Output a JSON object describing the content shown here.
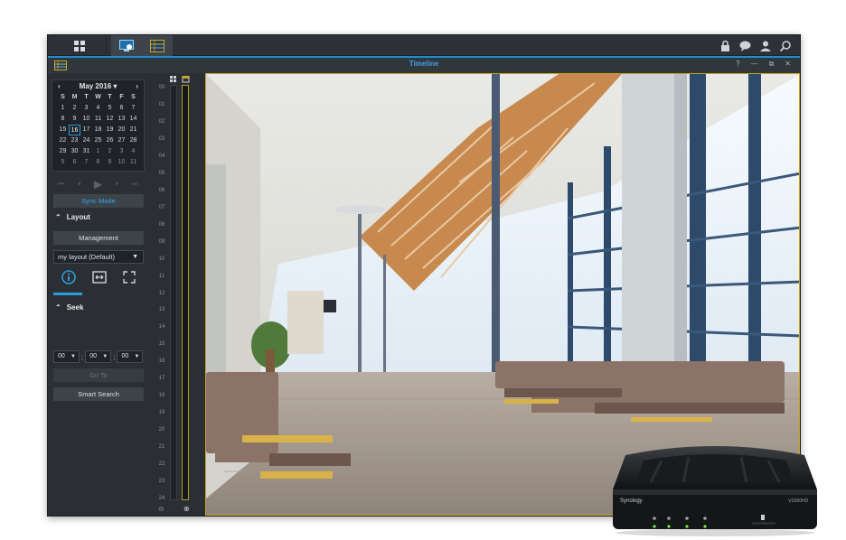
{
  "window": {
    "title": "Timeline",
    "controls": [
      "?",
      "—",
      "⧉",
      "✕"
    ]
  },
  "calendar": {
    "month_label": "May 2016",
    "prev": "‹",
    "next": "›",
    "dow": [
      "S",
      "M",
      "T",
      "W",
      "T",
      "F",
      "S"
    ],
    "weeks": [
      [
        "1",
        "2",
        "3",
        "4",
        "5",
        "6",
        "7"
      ],
      [
        "8",
        "9",
        "10",
        "11",
        "12",
        "13",
        "14"
      ],
      [
        "15",
        "16",
        "17",
        "18",
        "19",
        "20",
        "21"
      ],
      [
        "22",
        "23",
        "24",
        "25",
        "26",
        "27",
        "28"
      ],
      [
        "29",
        "30",
        "31",
        "1",
        "2",
        "3",
        "4"
      ],
      [
        "5",
        "6",
        "7",
        "8",
        "9",
        "10",
        "11"
      ]
    ],
    "selected_day": "16"
  },
  "sidebar": {
    "sync_mode": "Sync Mode",
    "layout_heading": "Layout",
    "management": "Management",
    "layout_select": "my layout (Default)",
    "seek_heading": "Seek",
    "seek_hour": "00",
    "seek_minute": "00",
    "seek_second": "00",
    "goto": "Go To",
    "smart_search": "Smart Search"
  },
  "timeline": {
    "hours": [
      "00",
      "01",
      "02",
      "03",
      "04",
      "05",
      "06",
      "07",
      "08",
      "09",
      "10",
      "11",
      "12",
      "13",
      "14",
      "15",
      "16",
      "17",
      "18",
      "19",
      "20",
      "21",
      "22",
      "23",
      "24"
    ]
  },
  "device": {
    "brand": "Synology",
    "model": "VS360HD"
  },
  "colors": {
    "accent": "#2b9be0",
    "track_highlight": "#c9a61f"
  }
}
